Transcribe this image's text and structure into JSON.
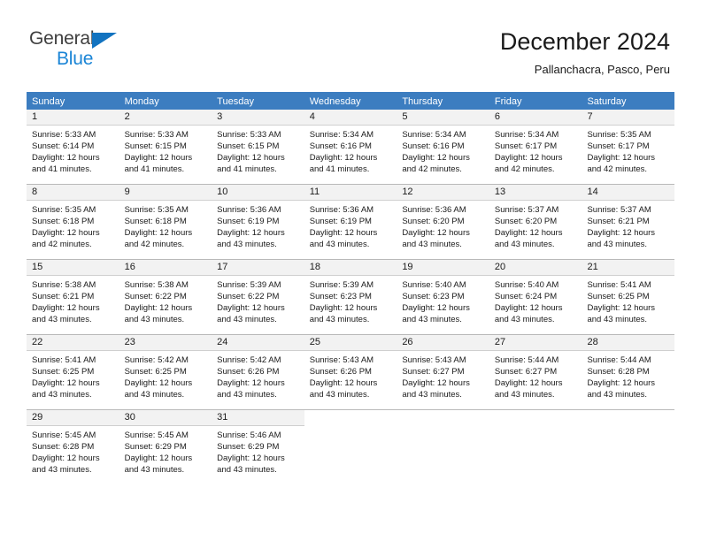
{
  "brand": {
    "name_primary": "General",
    "name_secondary": "Blue",
    "logo_icon": "triangle-icon",
    "primary_color": "#3f3f3f",
    "accent_color": "#1b85d6"
  },
  "header": {
    "month_title": "December 2024",
    "location": "Pallanchacra, Pasco, Peru"
  },
  "calendar": {
    "header_bg_color": "#3c7dc0",
    "daynum_bg_color": "#f2f2f2",
    "weekdays": [
      "Sunday",
      "Monday",
      "Tuesday",
      "Wednesday",
      "Thursday",
      "Friday",
      "Saturday"
    ],
    "weeks": [
      [
        {
          "day": "1",
          "sunrise": "Sunrise: 5:33 AM",
          "sunset": "Sunset: 6:14 PM",
          "daylight1": "Daylight: 12 hours",
          "daylight2": "and 41 minutes."
        },
        {
          "day": "2",
          "sunrise": "Sunrise: 5:33 AM",
          "sunset": "Sunset: 6:15 PM",
          "daylight1": "Daylight: 12 hours",
          "daylight2": "and 41 minutes."
        },
        {
          "day": "3",
          "sunrise": "Sunrise: 5:33 AM",
          "sunset": "Sunset: 6:15 PM",
          "daylight1": "Daylight: 12 hours",
          "daylight2": "and 41 minutes."
        },
        {
          "day": "4",
          "sunrise": "Sunrise: 5:34 AM",
          "sunset": "Sunset: 6:16 PM",
          "daylight1": "Daylight: 12 hours",
          "daylight2": "and 41 minutes."
        },
        {
          "day": "5",
          "sunrise": "Sunrise: 5:34 AM",
          "sunset": "Sunset: 6:16 PM",
          "daylight1": "Daylight: 12 hours",
          "daylight2": "and 42 minutes."
        },
        {
          "day": "6",
          "sunrise": "Sunrise: 5:34 AM",
          "sunset": "Sunset: 6:17 PM",
          "daylight1": "Daylight: 12 hours",
          "daylight2": "and 42 minutes."
        },
        {
          "day": "7",
          "sunrise": "Sunrise: 5:35 AM",
          "sunset": "Sunset: 6:17 PM",
          "daylight1": "Daylight: 12 hours",
          "daylight2": "and 42 minutes."
        }
      ],
      [
        {
          "day": "8",
          "sunrise": "Sunrise: 5:35 AM",
          "sunset": "Sunset: 6:18 PM",
          "daylight1": "Daylight: 12 hours",
          "daylight2": "and 42 minutes."
        },
        {
          "day": "9",
          "sunrise": "Sunrise: 5:35 AM",
          "sunset": "Sunset: 6:18 PM",
          "daylight1": "Daylight: 12 hours",
          "daylight2": "and 42 minutes."
        },
        {
          "day": "10",
          "sunrise": "Sunrise: 5:36 AM",
          "sunset": "Sunset: 6:19 PM",
          "daylight1": "Daylight: 12 hours",
          "daylight2": "and 43 minutes."
        },
        {
          "day": "11",
          "sunrise": "Sunrise: 5:36 AM",
          "sunset": "Sunset: 6:19 PM",
          "daylight1": "Daylight: 12 hours",
          "daylight2": "and 43 minutes."
        },
        {
          "day": "12",
          "sunrise": "Sunrise: 5:36 AM",
          "sunset": "Sunset: 6:20 PM",
          "daylight1": "Daylight: 12 hours",
          "daylight2": "and 43 minutes."
        },
        {
          "day": "13",
          "sunrise": "Sunrise: 5:37 AM",
          "sunset": "Sunset: 6:20 PM",
          "daylight1": "Daylight: 12 hours",
          "daylight2": "and 43 minutes."
        },
        {
          "day": "14",
          "sunrise": "Sunrise: 5:37 AM",
          "sunset": "Sunset: 6:21 PM",
          "daylight1": "Daylight: 12 hours",
          "daylight2": "and 43 minutes."
        }
      ],
      [
        {
          "day": "15",
          "sunrise": "Sunrise: 5:38 AM",
          "sunset": "Sunset: 6:21 PM",
          "daylight1": "Daylight: 12 hours",
          "daylight2": "and 43 minutes."
        },
        {
          "day": "16",
          "sunrise": "Sunrise: 5:38 AM",
          "sunset": "Sunset: 6:22 PM",
          "daylight1": "Daylight: 12 hours",
          "daylight2": "and 43 minutes."
        },
        {
          "day": "17",
          "sunrise": "Sunrise: 5:39 AM",
          "sunset": "Sunset: 6:22 PM",
          "daylight1": "Daylight: 12 hours",
          "daylight2": "and 43 minutes."
        },
        {
          "day": "18",
          "sunrise": "Sunrise: 5:39 AM",
          "sunset": "Sunset: 6:23 PM",
          "daylight1": "Daylight: 12 hours",
          "daylight2": "and 43 minutes."
        },
        {
          "day": "19",
          "sunrise": "Sunrise: 5:40 AM",
          "sunset": "Sunset: 6:23 PM",
          "daylight1": "Daylight: 12 hours",
          "daylight2": "and 43 minutes."
        },
        {
          "day": "20",
          "sunrise": "Sunrise: 5:40 AM",
          "sunset": "Sunset: 6:24 PM",
          "daylight1": "Daylight: 12 hours",
          "daylight2": "and 43 minutes."
        },
        {
          "day": "21",
          "sunrise": "Sunrise: 5:41 AM",
          "sunset": "Sunset: 6:25 PM",
          "daylight1": "Daylight: 12 hours",
          "daylight2": "and 43 minutes."
        }
      ],
      [
        {
          "day": "22",
          "sunrise": "Sunrise: 5:41 AM",
          "sunset": "Sunset: 6:25 PM",
          "daylight1": "Daylight: 12 hours",
          "daylight2": "and 43 minutes."
        },
        {
          "day": "23",
          "sunrise": "Sunrise: 5:42 AM",
          "sunset": "Sunset: 6:25 PM",
          "daylight1": "Daylight: 12 hours",
          "daylight2": "and 43 minutes."
        },
        {
          "day": "24",
          "sunrise": "Sunrise: 5:42 AM",
          "sunset": "Sunset: 6:26 PM",
          "daylight1": "Daylight: 12 hours",
          "daylight2": "and 43 minutes."
        },
        {
          "day": "25",
          "sunrise": "Sunrise: 5:43 AM",
          "sunset": "Sunset: 6:26 PM",
          "daylight1": "Daylight: 12 hours",
          "daylight2": "and 43 minutes."
        },
        {
          "day": "26",
          "sunrise": "Sunrise: 5:43 AM",
          "sunset": "Sunset: 6:27 PM",
          "daylight1": "Daylight: 12 hours",
          "daylight2": "and 43 minutes."
        },
        {
          "day": "27",
          "sunrise": "Sunrise: 5:44 AM",
          "sunset": "Sunset: 6:27 PM",
          "daylight1": "Daylight: 12 hours",
          "daylight2": "and 43 minutes."
        },
        {
          "day": "28",
          "sunrise": "Sunrise: 5:44 AM",
          "sunset": "Sunset: 6:28 PM",
          "daylight1": "Daylight: 12 hours",
          "daylight2": "and 43 minutes."
        }
      ],
      [
        {
          "day": "29",
          "sunrise": "Sunrise: 5:45 AM",
          "sunset": "Sunset: 6:28 PM",
          "daylight1": "Daylight: 12 hours",
          "daylight2": "and 43 minutes."
        },
        {
          "day": "30",
          "sunrise": "Sunrise: 5:45 AM",
          "sunset": "Sunset: 6:29 PM",
          "daylight1": "Daylight: 12 hours",
          "daylight2": "and 43 minutes."
        },
        {
          "day": "31",
          "sunrise": "Sunrise: 5:46 AM",
          "sunset": "Sunset: 6:29 PM",
          "daylight1": "Daylight: 12 hours",
          "daylight2": "and 43 minutes."
        },
        {
          "day": "",
          "sunrise": "",
          "sunset": "",
          "daylight1": "",
          "daylight2": ""
        },
        {
          "day": "",
          "sunrise": "",
          "sunset": "",
          "daylight1": "",
          "daylight2": ""
        },
        {
          "day": "",
          "sunrise": "",
          "sunset": "",
          "daylight1": "",
          "daylight2": ""
        },
        {
          "day": "",
          "sunrise": "",
          "sunset": "",
          "daylight1": "",
          "daylight2": ""
        }
      ]
    ]
  }
}
